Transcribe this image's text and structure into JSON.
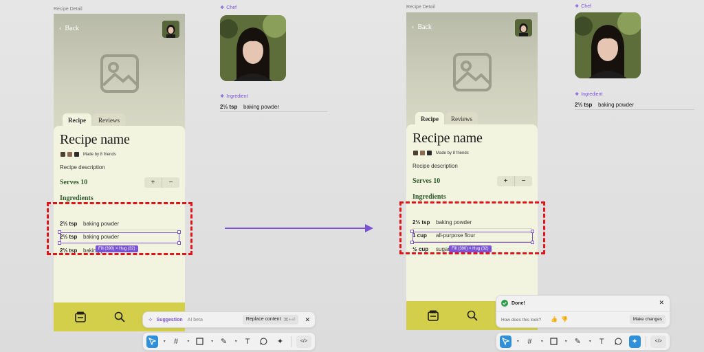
{
  "frames": {
    "left_label": "Recipe Detail",
    "right_label": "Recipe Detail"
  },
  "phone_left": {
    "back_label": "Back",
    "tabs": [
      {
        "label": "Recipe"
      },
      {
        "label": "Reviews"
      }
    ],
    "title": "Recipe name",
    "friends_text": "Made by 8 friends",
    "description": "Recipe description",
    "serves_label": "Serves 10",
    "plus": "+",
    "minus": "−",
    "ingredients_title": "Ingredients",
    "ingredients": [
      {
        "amount": "2⅓ tsp",
        "name": "baking powder"
      },
      {
        "amount": "2⅓ tsp",
        "name": "baking powder"
      },
      {
        "amount": "2⅓ tsp",
        "name": "baking powder"
      }
    ],
    "selection_badge": "Fill (390) × Hug (32)"
  },
  "phone_right": {
    "back_label": "Back",
    "tabs": [
      {
        "label": "Recipe"
      },
      {
        "label": "Reviews"
      }
    ],
    "title": "Recipe name",
    "friends_text": "Made by 8 friends",
    "description": "Recipe description",
    "serves_label": "Serves 10",
    "plus": "+",
    "minus": "−",
    "ingredients_title": "Ingredients",
    "ingredients": [
      {
        "amount": "2⅓ tsp",
        "name": "baking powder"
      },
      {
        "amount": "1 cup",
        "name": "all-purpose flour"
      },
      {
        "amount": "½ cup",
        "name": "sugar"
      }
    ],
    "selection_badge": "Fill (390) × Hug (32)"
  },
  "chef_left": {
    "label": "Chef"
  },
  "chef_right": {
    "label": "Chef"
  },
  "ingredient_left": {
    "label": "Ingredient",
    "amount": "2⅓ tsp",
    "name": "baking powder"
  },
  "ingredient_right": {
    "label": "Ingredient",
    "amount": "2⅓ tsp",
    "name": "baking powder"
  },
  "suggestion_bar": {
    "label": "Suggestion",
    "badge": "AI beta",
    "action": "Replace content",
    "shortcut": "⌘+⏎",
    "close": "✕"
  },
  "done_panel": {
    "title": "Done!",
    "question": "How does this look?",
    "action": "Make changes",
    "close": "✕"
  },
  "toolbar": {
    "text_tool": "T",
    "code_tool": "</>"
  },
  "colors": {
    "accent_purple": "#7b52d6",
    "highlight_red": "#e0151a",
    "bottom_nav": "#d3cf4a",
    "heading_green": "#2e5a2b",
    "active_tool": "#2f8fd8"
  }
}
